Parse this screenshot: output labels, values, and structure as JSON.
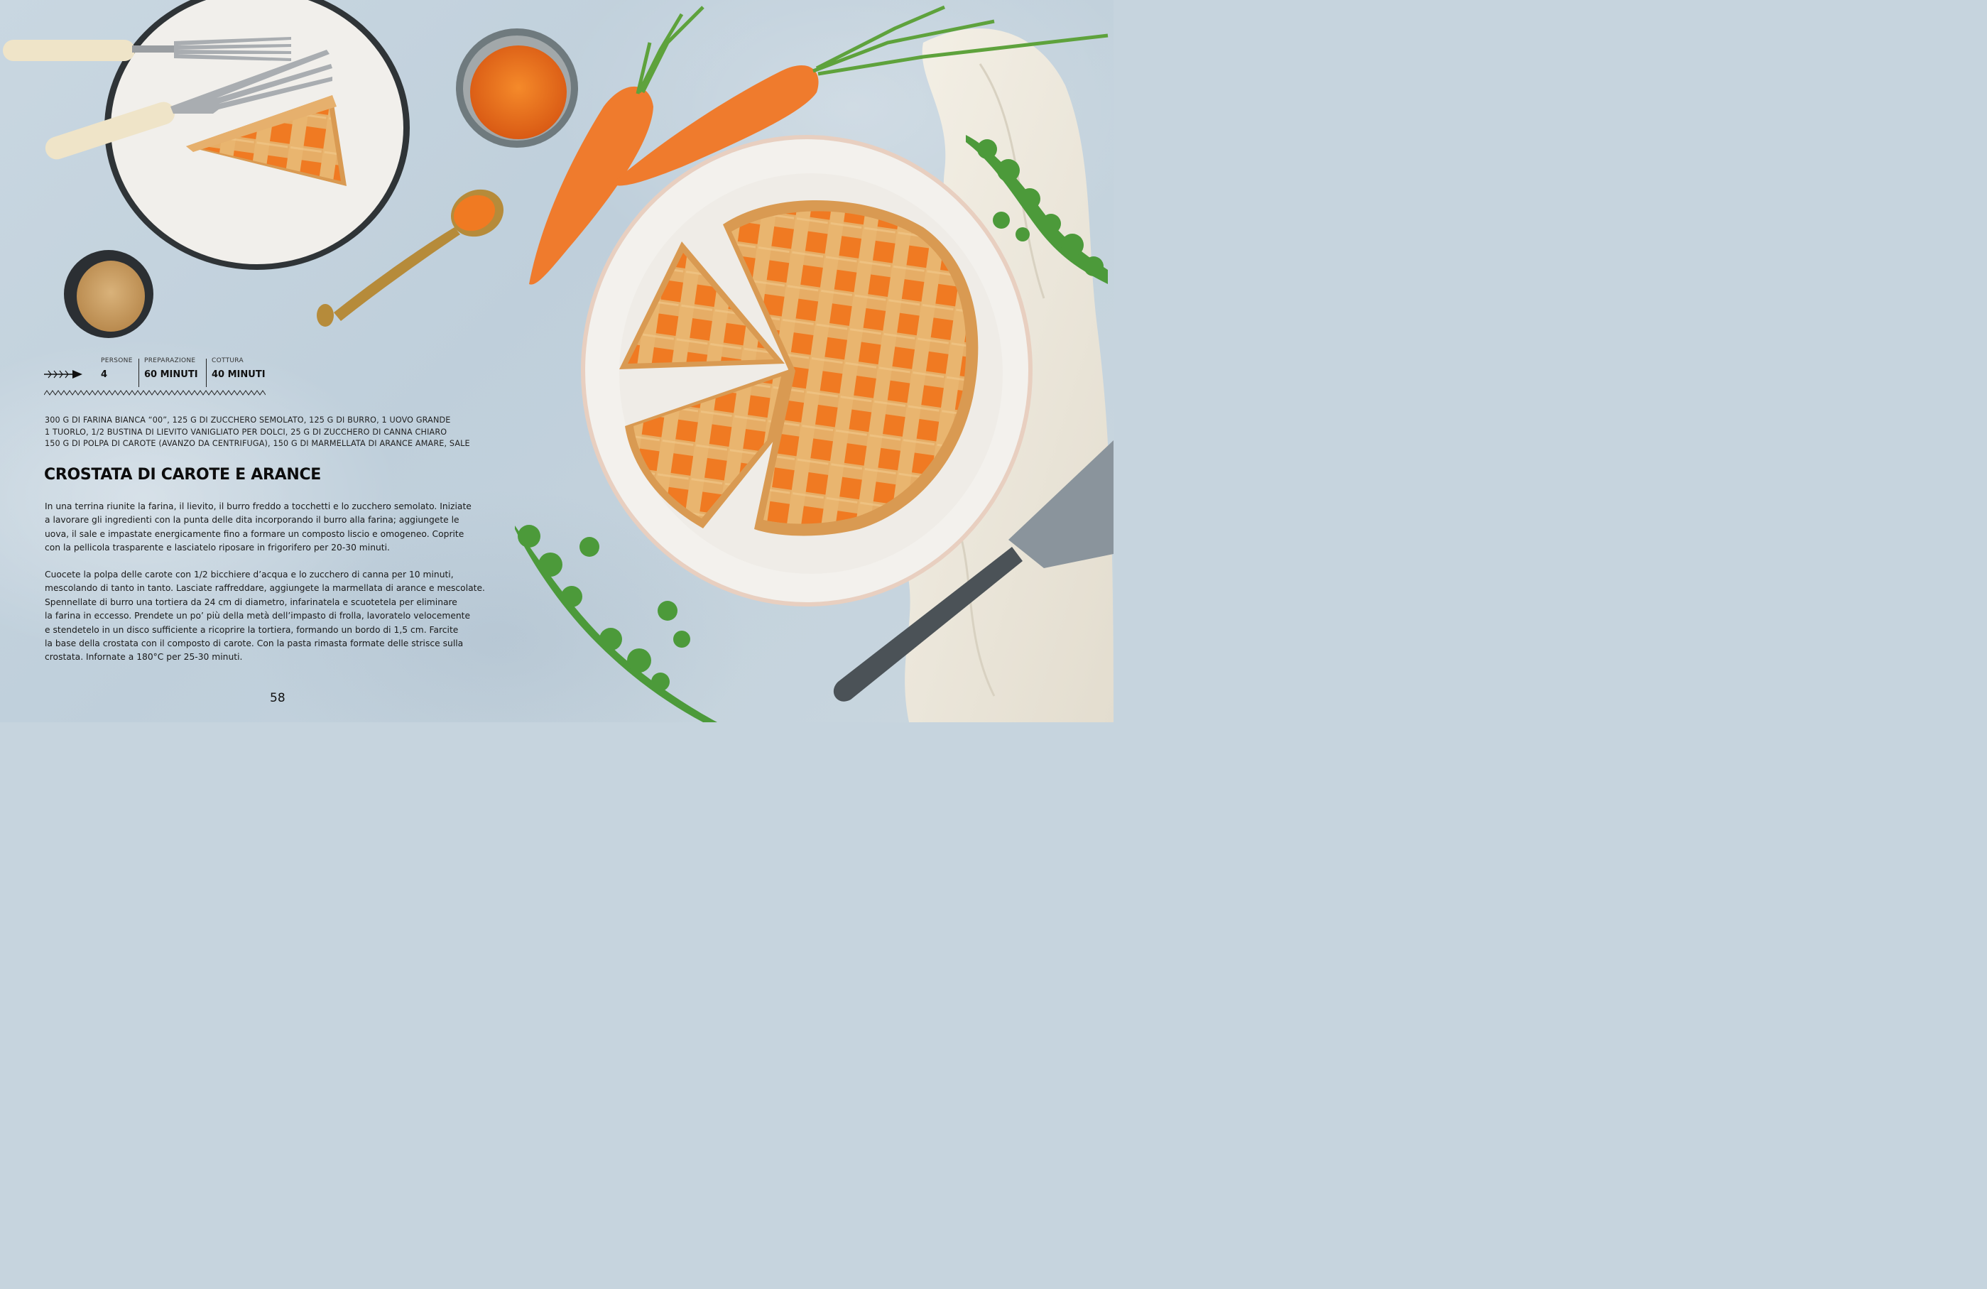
{
  "recipe": {
    "meta": {
      "persone_label": "PERSONE",
      "persone_value": "4",
      "preparazione_label": "PREPARAZIONE",
      "preparazione_value": "60 MINUTI",
      "cottura_label": "COTTURA",
      "cottura_value": "40 MINUTI"
    },
    "ingredients": [
      "300 G DI FARINA BIANCA “00”, 125 G DI ZUCCHERO SEMOLATO, 125 G DI BURRO, 1 UOVO GRANDE",
      "1 TUORLO, 1/2 BUSTINA DI LIEVITO VANIGLIATO PER DOLCI, 25 G DI ZUCCHERO DI CANNA CHIARO",
      "150 G DI POLPA DI CAROTE (AVANZO DA CENTRIFUGA), 150 G DI MARMELLATA DI ARANCE AMARE, SALE"
    ],
    "title": "CROSTATA DI CAROTE E ARANCE",
    "paragraph1": [
      "In una terrina riunite la farina, il lievito, il burro freddo a tocchetti e lo zucchero semolato. Iniziate",
      "a lavorare gli ingredienti con la punta delle dita incorporando il burro alla farina; aggiungete le",
      "uova, il sale e impastate energicamente fino a formare un composto liscio e omogeneo. Coprite",
      "con la pellicola trasparente e lasciatelo riposare in frigorifero per 20-30 minuti."
    ],
    "paragraph2": [
      "Cuocete la polpa delle carote con 1/2 bicchiere d’acqua e lo zucchero di canna per 10 minuti,",
      "mescolando di tanto in tanto. Lasciate raffreddare, aggiungete la marmellata di arance e mescolate.",
      "Spennellate di burro una tortiera da 24 cm di diametro, infarinatela e scuotetela per eliminare",
      "la farina in eccesso. Prendete un po’ più della metà dell’impasto di frolla, lavoratelo velocemente",
      "e stendetelo in un disco sufficiente a ricoprire la tortiera, formando un bordo di 1,5 cm. Farcite",
      "la base della crostata con il composto di carote. Con la pasta rimasta formate delle strisce sulla",
      "crostata. Infornate a 180°C per 25-30 minuti."
    ],
    "page_number": "58"
  },
  "icons": {
    "arrow": "fishbone-arrow-icon",
    "zigzag": "zigzag-divider-icon"
  },
  "colors": {
    "background": "#c6d4de",
    "plate": "#f3f1ed",
    "crust": "#e2a860",
    "jam": "#f07a22",
    "carrot": "#ee7a2e",
    "leaf": "#4c9a3a"
  }
}
